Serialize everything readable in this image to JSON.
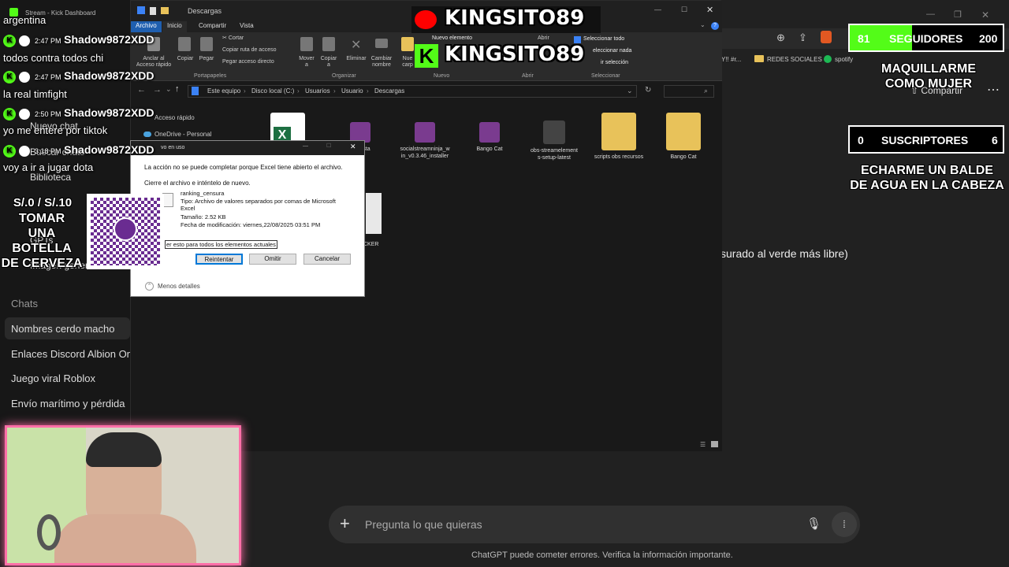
{
  "sidebar": {
    "new_chat": "Nuevo chat",
    "search": "Buscar chats",
    "library": "Biblioteca",
    "gpts": "GPTs",
    "image": "Imagen generada",
    "chats_header": "Chats",
    "chats": [
      "Nombres cerdo macho",
      "Enlaces Discord Albion Onlin",
      "Juego viral Roblox",
      "Envío marítimo y pérdida"
    ]
  },
  "browser": {
    "bookmarks": [
      "Y!! #r...",
      "REDES SOCIALES",
      "spotify"
    ],
    "share": "Compartir",
    "partial_text": "surado al verde más libre)"
  },
  "composer": {
    "placeholder": "Pregunta lo que quieras",
    "footer": "ChatGPT puede cometer errores. Verifica la información importante."
  },
  "explorer": {
    "window_title": "Descargas",
    "obs_title": "Stream - Kick Dashboard",
    "tabs": [
      "Archivo",
      "Inicio",
      "Compartir",
      "Vista"
    ],
    "ribbon": {
      "anchor": "Anclar al\nAcceso rápido",
      "copy": "Copiar",
      "paste": "Pegar",
      "cut": "Cortar",
      "copy_path": "Copiar ruta de acceso",
      "paste_shortcut": "Pegar acceso directo",
      "move": "Mover\na",
      "copy_to": "Copiar\na",
      "delete": "Eliminar",
      "rename": "Cambiar\nnombre",
      "new_folder": "Nue\ncarp",
      "new_item": "Nuevo elemento",
      "open": "Abrir",
      "select_all": "Seleccionar todo",
      "select_none": "eleccionar nada",
      "invert": "ir selección",
      "group_clipboard": "Portapapeles",
      "group_organize": "Organizar",
      "group_new": "Nuevo",
      "group_open": "Abrir",
      "group_select": "Seleccionar"
    },
    "path": [
      "Este equipo",
      "Disco local (C:)",
      "Usuarios",
      "Usuario",
      "Descargas"
    ],
    "nav": [
      "Acceso rápido",
      "OneDrive - Personal"
    ],
    "files": [
      {
        "name": "",
        "color": "#1d6f42"
      },
      {
        "name": "nerInsta\nta5",
        "color": "#7a3b8f"
      },
      {
        "name": "socialstreamninja_w\nin_v0.3.46_installer",
        "color": "#7a3b8f"
      },
      {
        "name": "Bango Cat",
        "color": "#7a3b8f"
      },
      {
        "name": "obs-streamelement\ns-setup-latest",
        "color": "#444"
      },
      {
        "name": "scripts obs recursos",
        "color": "#e8c25a"
      },
      {
        "name": "Bango Cat",
        "color": "#e8c25a"
      }
    ],
    "extra_file": "CKER"
  },
  "dialog": {
    "title": "vo en uso",
    "message": "La acción no se puede completar porque Excel tiene abierto el archivo.",
    "hint": "Cierre el archivo e inténtelo de nuevo.",
    "file_name": "ranking_censura",
    "file_type": "Tipo: Archivo de valores separados por comas de Microsoft Excel",
    "file_size": "Tamaño: 2.52 KB",
    "file_date": "Fecha de modificación: viernes,22/08/2025 03:51 PM",
    "checkbox": "er esto para todos los elementos actuales",
    "retry": "Reintentar",
    "skip": "Omitir",
    "cancel": "Cancelar",
    "less_details": "Menos detalles"
  },
  "stream": {
    "top_line": "argentina",
    "chat": [
      {
        "time": "2:47 PM",
        "user": "Shadow9872XDD",
        "msg": "todos contra todos chi"
      },
      {
        "time": "2:47 PM",
        "user": "Shadow9872XDD",
        "msg": "la real timfight"
      },
      {
        "time": "2:50 PM",
        "user": "Shadow9872XDD",
        "msg": "yo me entere por tiktok"
      },
      {
        "time": "3:18 PM",
        "user": "Shadow9872XDD",
        "msg": "voy a ir a jugar dota"
      }
    ],
    "price": "S/.0 / S/.10",
    "goal_text": "TOMAR\nUNA\nBOTELLA\nDE CERVEZA",
    "channel_youtube": "KINGSITO89",
    "channel_kick": "KINGSITO89",
    "followers": {
      "current": "81",
      "label": "SEGUIDORES",
      "target": "200",
      "fraction": 0.405
    },
    "followers_goal": "MAQUILLARME\nCOMO MUJER",
    "subs": {
      "current": "0",
      "label": "SUSCRIPTORES",
      "target": "6"
    },
    "subs_goal": "ECHARME UN BALDE\nDE AGUA EN LA CABEZA",
    "colors": {
      "kick": "#53fc18",
      "youtube": "#ff0000",
      "yape": "#6a2c91"
    }
  }
}
